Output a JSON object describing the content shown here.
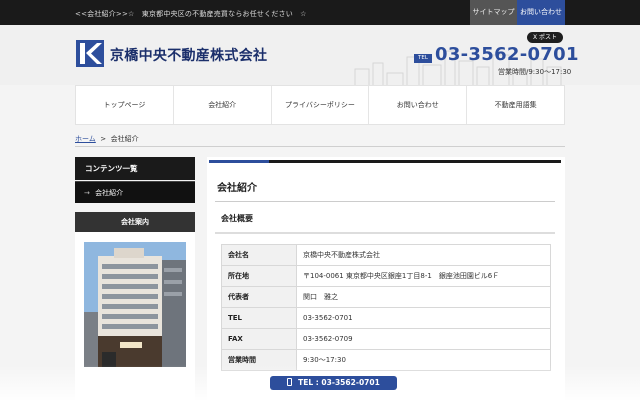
{
  "topbar": {
    "tagline": "<<会社紹介>>☆　東京都中央区の不動産売買ならお任せください　☆",
    "sitemap_label": "サイトマップ",
    "contact_label": "お問い合わせ"
  },
  "header": {
    "company_name": "京橋中央不動産株式会社",
    "xpost_label": "X ポスト",
    "tel_badge": "TEL",
    "tel_number": "03-3562-0701",
    "hours": "営業時間/9:30〜17:30"
  },
  "nav": {
    "items": [
      {
        "label": "トップページ"
      },
      {
        "label": "会社紹介"
      },
      {
        "label": "プライバシーポリシー"
      },
      {
        "label": "お問い合わせ"
      },
      {
        "label": "不動産用語集"
      }
    ]
  },
  "breadcrumb": {
    "home": "ホーム",
    "separator": ">",
    "current": "会社紹介"
  },
  "sidebar": {
    "contents_heading": "コンテンツ一覧",
    "item_arrow": "→",
    "item_label": "会社紹介",
    "company_heading": "会社案内"
  },
  "main": {
    "title": "会社紹介",
    "section_title": "会社概要",
    "rows": [
      {
        "label": "会社名",
        "value": "京橋中央不動産株式会社"
      },
      {
        "label": "所在地",
        "value": "〒104-0061 東京都中央区銀座1丁目8-1　銀座池田園ビル6Ｆ"
      },
      {
        "label": "代表者",
        "value": "関口　雅之"
      },
      {
        "label": "TEL",
        "value": "03-3562-0701"
      },
      {
        "label": "FAX",
        "value": "03-3562-0709"
      },
      {
        "label": "営業時間",
        "value": "9:30〜17:30"
      }
    ]
  },
  "float_bar": {
    "label": "TEL : 03-3562-0701"
  },
  "colors": {
    "brand_blue": "#2d4e9c",
    "dark": "#1a1a1a"
  }
}
